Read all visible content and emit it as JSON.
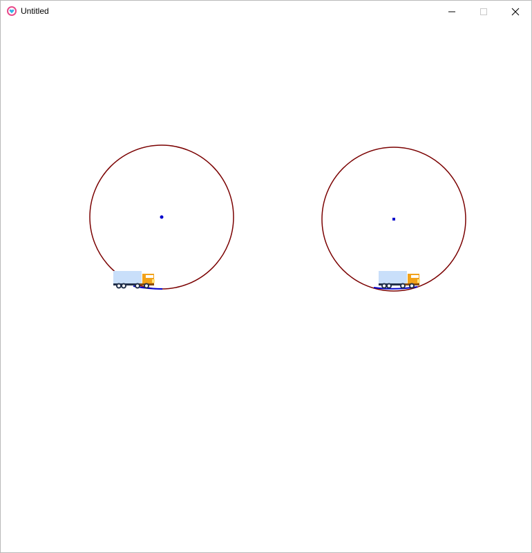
{
  "window": {
    "title": "Untitled",
    "icon": "heart-app-icon",
    "controls": [
      "minimize-icon",
      "maximize-icon",
      "close-icon"
    ]
  },
  "scene": {
    "circle_color": "#7a0000",
    "center_dot_color": "#0000cc",
    "track_color": "#0000cc",
    "truck": {
      "trailer_color": "#c9dffa",
      "cab_color": "#f2a21a",
      "chassis_color": "#22304a"
    }
  }
}
